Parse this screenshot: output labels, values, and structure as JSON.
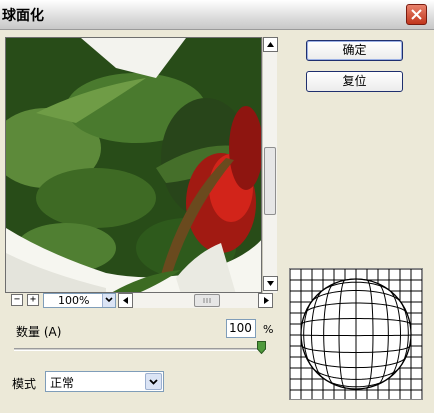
{
  "window": {
    "title": "球面化"
  },
  "buttons": {
    "ok": "确定",
    "reset": "复位"
  },
  "preview": {
    "zoom": "100%"
  },
  "amount": {
    "label": "数量 (A)",
    "value": "100",
    "unit": "%",
    "level": 1.0
  },
  "mode": {
    "label": "模式",
    "selected": "正常"
  },
  "icons": {
    "close": "close-icon",
    "scroll_up": "arrow-up-icon",
    "scroll_down": "arrow-down-icon",
    "scroll_left": "arrow-left-icon",
    "scroll_right": "arrow-right-icon",
    "zoom_out": "minus-icon",
    "zoom_in": "plus-icon",
    "dropdown": "chevron-down-icon"
  }
}
